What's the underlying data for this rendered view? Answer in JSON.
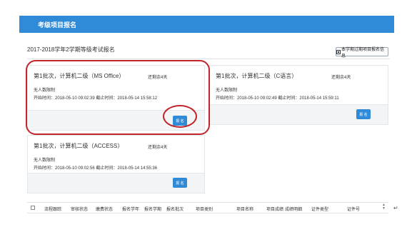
{
  "header": {
    "title": "考级项目报名"
  },
  "page": {
    "subtitle": "2017-2018学年2学期等级考试报名",
    "past_button_label": "本学期过期项目报名信息"
  },
  "cards": [
    {
      "title": "第1批次，计算机二级（MS Office）",
      "remaining": "还剩余4天",
      "limit": "无人数限制",
      "time": "开始时间：2018-05-10 09:02:39  截止时间：2018-05-14 15:58:12",
      "button": "报 名"
    },
    {
      "title": "第1批次，计算机二级（C语言）",
      "remaining": "还剩余4天",
      "limit": "无人数限制",
      "time": "开始时间：2018-05-10 09:02:49  截止时间：2018-05-14 15:59:11",
      "button": "报 名"
    },
    {
      "title": "第1批次，计算机二级（ACCESS）",
      "remaining": "还剩余4天",
      "limit": "无人数限制",
      "time": "开始时间：2018-05-10 09:02:56  截止时间：2018-05-14 14:55:36",
      "button": "报 名"
    }
  ],
  "table": {
    "columns": [
      "流程跟踪",
      "审核状态",
      "缴费状态",
      "报名学年",
      "报名学期",
      "报名批次",
      "项目类别",
      "项目名称",
      "项目成绩",
      "成绩明细",
      "证件类型",
      "证件号"
    ]
  },
  "colors": {
    "accent": "#2f8ad8",
    "highlight": "#c0262c"
  }
}
